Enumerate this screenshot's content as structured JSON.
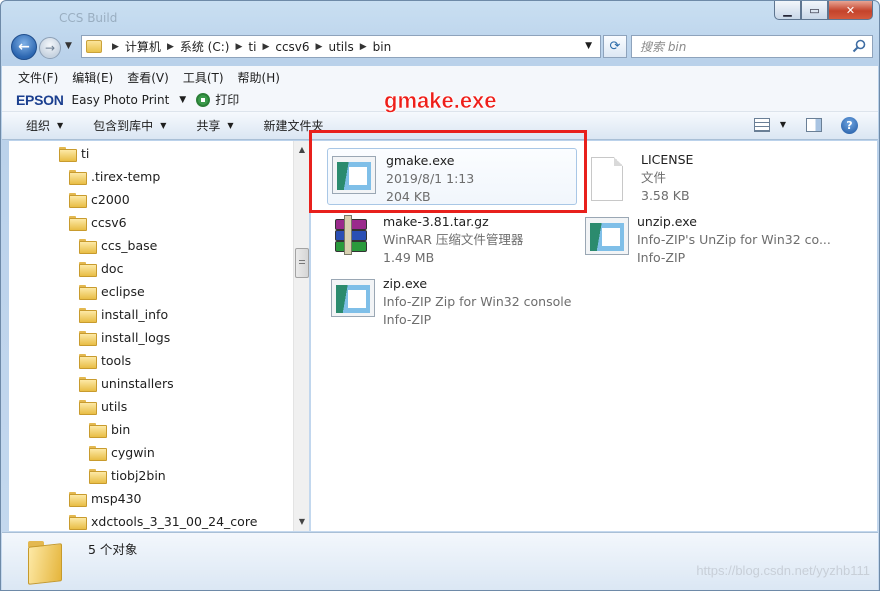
{
  "window": {
    "title": "CCS Build"
  },
  "nav": {
    "breadcrumbs": [
      "计算机",
      "系统 (C:)",
      "ti",
      "ccsv6",
      "utils",
      "bin"
    ],
    "search_placeholder": "搜索 bin"
  },
  "menu": [
    "文件(F)",
    "编辑(E)",
    "查看(V)",
    "工具(T)",
    "帮助(H)"
  ],
  "epson": {
    "logo": "EPSON",
    "app": "Easy Photo Print",
    "print": "打印"
  },
  "commands": [
    {
      "label": "组织",
      "has_dropdown": true
    },
    {
      "label": "包含到库中",
      "has_dropdown": true
    },
    {
      "label": "共享",
      "has_dropdown": true
    },
    {
      "label": "新建文件夹",
      "has_dropdown": false
    }
  ],
  "tree": [
    {
      "label": "ti",
      "level": 0
    },
    {
      "label": ".tirex-temp",
      "level": 1
    },
    {
      "label": "c2000",
      "level": 1
    },
    {
      "label": "ccsv6",
      "level": 1
    },
    {
      "label": "ccs_base",
      "level": 2
    },
    {
      "label": "doc",
      "level": 2
    },
    {
      "label": "eclipse",
      "level": 2
    },
    {
      "label": "install_info",
      "level": 2
    },
    {
      "label": "install_logs",
      "level": 2
    },
    {
      "label": "tools",
      "level": 2
    },
    {
      "label": "uninstallers",
      "level": 2
    },
    {
      "label": "utils",
      "level": 2
    },
    {
      "label": "bin",
      "level": 3,
      "selected": true
    },
    {
      "label": "cygwin",
      "level": 3
    },
    {
      "label": "tiobj2bin",
      "level": 3
    },
    {
      "label": "msp430",
      "level": 1
    },
    {
      "label": "xdctools_3_31_00_24_core",
      "level": 1
    }
  ],
  "files": [
    {
      "name": "gmake.exe",
      "line2": "2019/8/1 1:13",
      "line3": "204 KB",
      "icon": "exe-icon",
      "selected": true
    },
    {
      "name": "LICENSE",
      "line2": "文件",
      "line3": "3.58 KB",
      "icon": "document-icon"
    },
    {
      "name": "make-3.81.tar.gz",
      "line2": "WinRAR 压缩文件管理器",
      "line3": "1.49 MB",
      "icon": "winrar-archive-icon"
    },
    {
      "name": "unzip.exe",
      "line2": "Info-ZIP's UnZip for Win32 co...",
      "line3": "Info-ZIP",
      "icon": "exe-icon"
    },
    {
      "name": "zip.exe",
      "line2": "Info-ZIP Zip for Win32 console",
      "line3": "Info-ZIP",
      "icon": "exe-icon"
    }
  ],
  "annotation": {
    "label": "gmake.exe",
    "color": "#e8201c"
  },
  "status": {
    "count": "5 个对象"
  },
  "watermark": "https://blog.csdn.net/yyzhb111"
}
